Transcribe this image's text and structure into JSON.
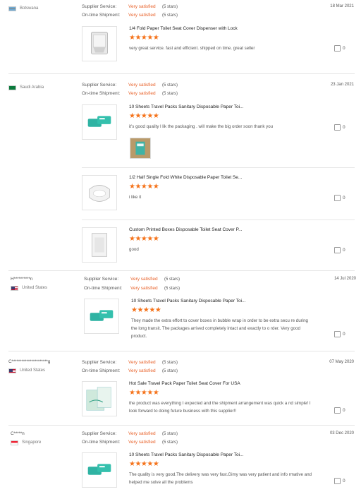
{
  "labels": {
    "supplier": "Supplier Service:",
    "shipment": "On-time Shipment:",
    "stars": "(5 stars)"
  },
  "reviews": [
    {
      "buyer": "",
      "country": "Botswana",
      "supplier": "Very satisfied",
      "shipment": "Very satisfied",
      "date": "18 Mar 2021",
      "items": [
        {
          "title": "1/4 Fold Paper Toilet Seat Cover Dispenser with Lock",
          "rating": "★★★★★",
          "text": "very great service. fast and efficient. shipped on time. great seller",
          "likes": "0"
        }
      ]
    },
    {
      "buyer": "",
      "country": "Saudi Arabia",
      "supplier": "Very satisfied",
      "shipment": "Very satisfied",
      "date": "23 Jan 2021",
      "items": [
        {
          "title": "10 Sheets Travel Packs Sanitary Disposable Paper Toi...",
          "rating": "★★★★★",
          "text": "it's good quality l lik the packaging . will make the big order soon thank you",
          "likes": "0"
        },
        {
          "title": "1/2 Half Single Fold White Disposable Paper Toilet Se...",
          "rating": "★★★★★",
          "text": "i like it",
          "likes": "0"
        },
        {
          "title": "Custom Printed Boxes Disposable Toilet Seat Cover P...",
          "rating": "★★★★★",
          "text": "good",
          "likes": "0"
        }
      ]
    },
    {
      "buyer": "H**********n",
      "country": "United States",
      "supplier": "Very satisfied",
      "shipment": "Very satisfied",
      "date": "14 Jul 2020",
      "items": [
        {
          "title": "10 Sheets Travel Packs Sanitary Disposable Paper Toi...",
          "rating": "★★★★★",
          "text": "They made the extra effort to cover boxes in bubble wrap in order to be extra secu re during the long transit.  The packages arrived completely intact and exactly to o rder.  Very good product.",
          "likes": "0"
        }
      ]
    },
    {
      "buyer": "C**********************g",
      "country": "United States",
      "supplier": "Very satisfied",
      "shipment": "Very satisfied",
      "date": "07 May 2020",
      "items": [
        {
          "title": "Hot Sale Travel Pack Paper Toilet Seat Cover For USA",
          "rating": "★★★★★",
          "text": "the product was everything I expected and the shipment arrangement was quick a nd simple! I look forward to doing future business with this supplier!!",
          "likes": "0"
        }
      ]
    },
    {
      "buyer": "C*****n",
      "country": "Singapore",
      "supplier": "Very satisfied",
      "shipment": "Very satisfied",
      "date": "03 Dec 2020",
      "items": [
        {
          "title": "10 Sheets Travel Packs Sanitary Disposable Paper Toi...",
          "rating": "★★★★★",
          "text": "The quality is very good.The delivery was very fast.Gimy was very patient and info rmative and helped me solve all the problems",
          "likes": "0"
        }
      ]
    }
  ],
  "flag_colors": {
    "botswana": "#6da9d2",
    "saudi": "#0b7a3c",
    "us_red": "#c8102e",
    "us_blue": "#3c3b6e",
    "singapore": "#ee2536"
  }
}
